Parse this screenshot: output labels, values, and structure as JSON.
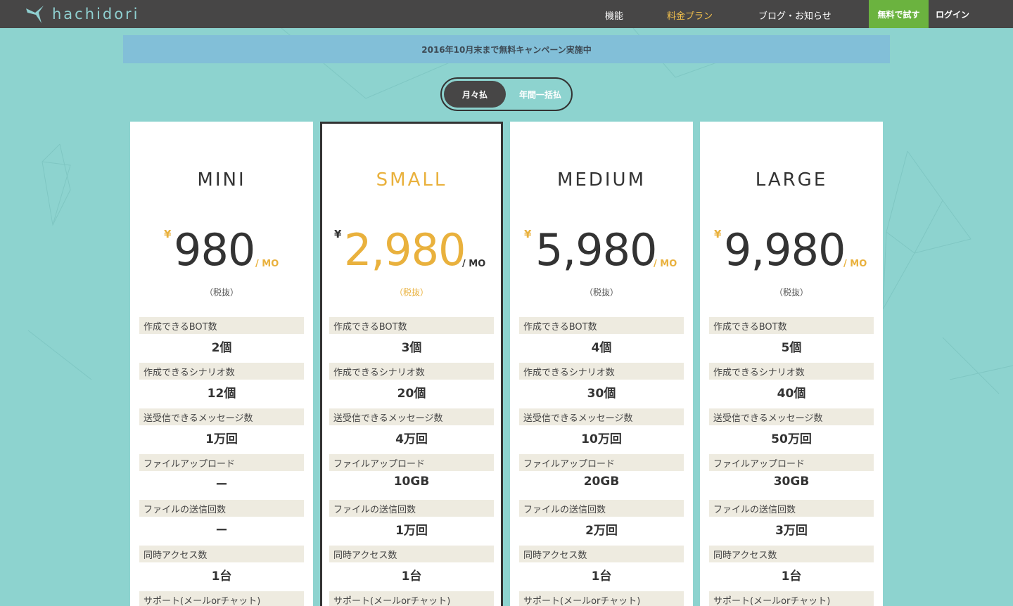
{
  "header": {
    "logo_text": "hachidori",
    "nav": [
      "機能",
      "料金プラン",
      "ブログ・お知らせ"
    ],
    "active_nav": "料金プラン",
    "trial_button": "無料で試す",
    "login": "ログイン",
    "colors": {
      "bar": "#474646",
      "active": "#f3c14d",
      "trial": "#6bb33f"
    }
  },
  "banner": {
    "text": "2016年10月末まで無料キャンペーン実施中"
  },
  "billing_toggle": {
    "monthly": "月々払",
    "yearly": "年間一括払",
    "selected": "月々払"
  },
  "plans": [
    {
      "name": "MINI",
      "yen": "¥",
      "price": "980",
      "per": "/ MO",
      "tax": "（税抜）",
      "features": [
        {
          "label": "作成できるBOT数",
          "value": "2個"
        },
        {
          "label": "作成できるシナリオ数",
          "value": "12個"
        },
        {
          "label": "送受信できるメッセージ数",
          "value": "1万回"
        },
        {
          "label": "ファイルアップロード",
          "value": "ー"
        },
        {
          "label": "ファイルの送信回数",
          "value": "ー"
        },
        {
          "label": "同時アクセス数",
          "value": "1台"
        },
        {
          "label": "サポート(メールorチャット)",
          "value": ""
        }
      ]
    },
    {
      "name": "SMALL",
      "yen": "¥",
      "price": "2,980",
      "per": "/ MO",
      "tax": "（税抜）",
      "featured": true,
      "features": [
        {
          "label": "作成できるBOT数",
          "value": "3個"
        },
        {
          "label": "作成できるシナリオ数",
          "value": "20個"
        },
        {
          "label": "送受信できるメッセージ数",
          "value": "4万回"
        },
        {
          "label": "ファイルアップロード",
          "value": "10GB"
        },
        {
          "label": "ファイルの送信回数",
          "value": "1万回"
        },
        {
          "label": "同時アクセス数",
          "value": "1台"
        },
        {
          "label": "サポート(メールorチャット)",
          "value": ""
        }
      ]
    },
    {
      "name": "MEDIUM",
      "yen": "¥",
      "price": "5,980",
      "per": "/ MO",
      "tax": "（税抜）",
      "features": [
        {
          "label": "作成できるBOT数",
          "value": "4個"
        },
        {
          "label": "作成できるシナリオ数",
          "value": "30個"
        },
        {
          "label": "送受信できるメッセージ数",
          "value": "10万回"
        },
        {
          "label": "ファイルアップロード",
          "value": "20GB"
        },
        {
          "label": "ファイルの送信回数",
          "value": "2万回"
        },
        {
          "label": "同時アクセス数",
          "value": "1台"
        },
        {
          "label": "サポート(メールorチャット)",
          "value": ""
        }
      ]
    },
    {
      "name": "LARGE",
      "yen": "¥",
      "price": "9,980",
      "per": "/ MO",
      "tax": "（税抜）",
      "features": [
        {
          "label": "作成できるBOT数",
          "value": "5個"
        },
        {
          "label": "作成できるシナリオ数",
          "value": "40個"
        },
        {
          "label": "送受信できるメッセージ数",
          "value": "50万回"
        },
        {
          "label": "ファイルアップロード",
          "value": "30GB"
        },
        {
          "label": "ファイルの送信回数",
          "value": "3万回"
        },
        {
          "label": "同時アクセス数",
          "value": "1台"
        },
        {
          "label": "サポート(メールorチャット)",
          "value": ""
        }
      ]
    }
  ]
}
